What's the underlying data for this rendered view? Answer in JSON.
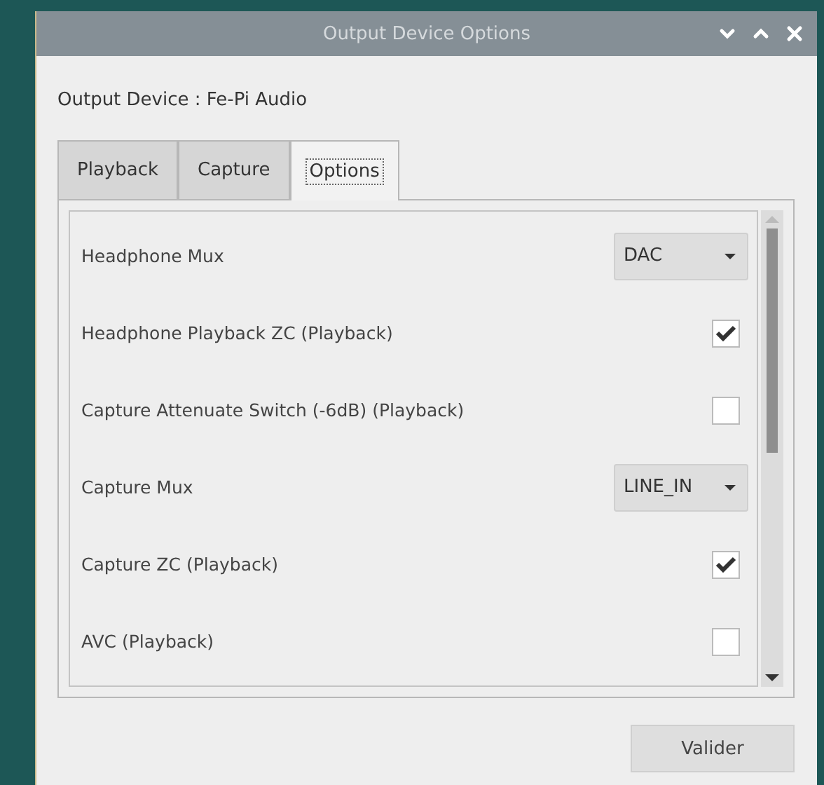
{
  "window": {
    "title": "Output Device Options"
  },
  "device_label": "Output Device : Fe-Pi Audio",
  "tabs": [
    {
      "label": "Playback",
      "selected": false
    },
    {
      "label": "Capture",
      "selected": false
    },
    {
      "label": "Options",
      "selected": true
    }
  ],
  "options": [
    {
      "kind": "dropdown",
      "label": "Headphone Mux",
      "value": "DAC"
    },
    {
      "kind": "checkbox",
      "label": "Headphone Playback ZC (Playback)",
      "checked": true
    },
    {
      "kind": "checkbox",
      "label": "Capture Attenuate Switch (-6dB) (Playback)",
      "checked": false
    },
    {
      "kind": "dropdown",
      "label": "Capture Mux",
      "value": "LINE_IN"
    },
    {
      "kind": "checkbox",
      "label": "Capture ZC (Playback)",
      "checked": true
    },
    {
      "kind": "checkbox",
      "label": "AVC (Playback)",
      "checked": false
    }
  ],
  "buttons": [
    "Valider"
  ]
}
